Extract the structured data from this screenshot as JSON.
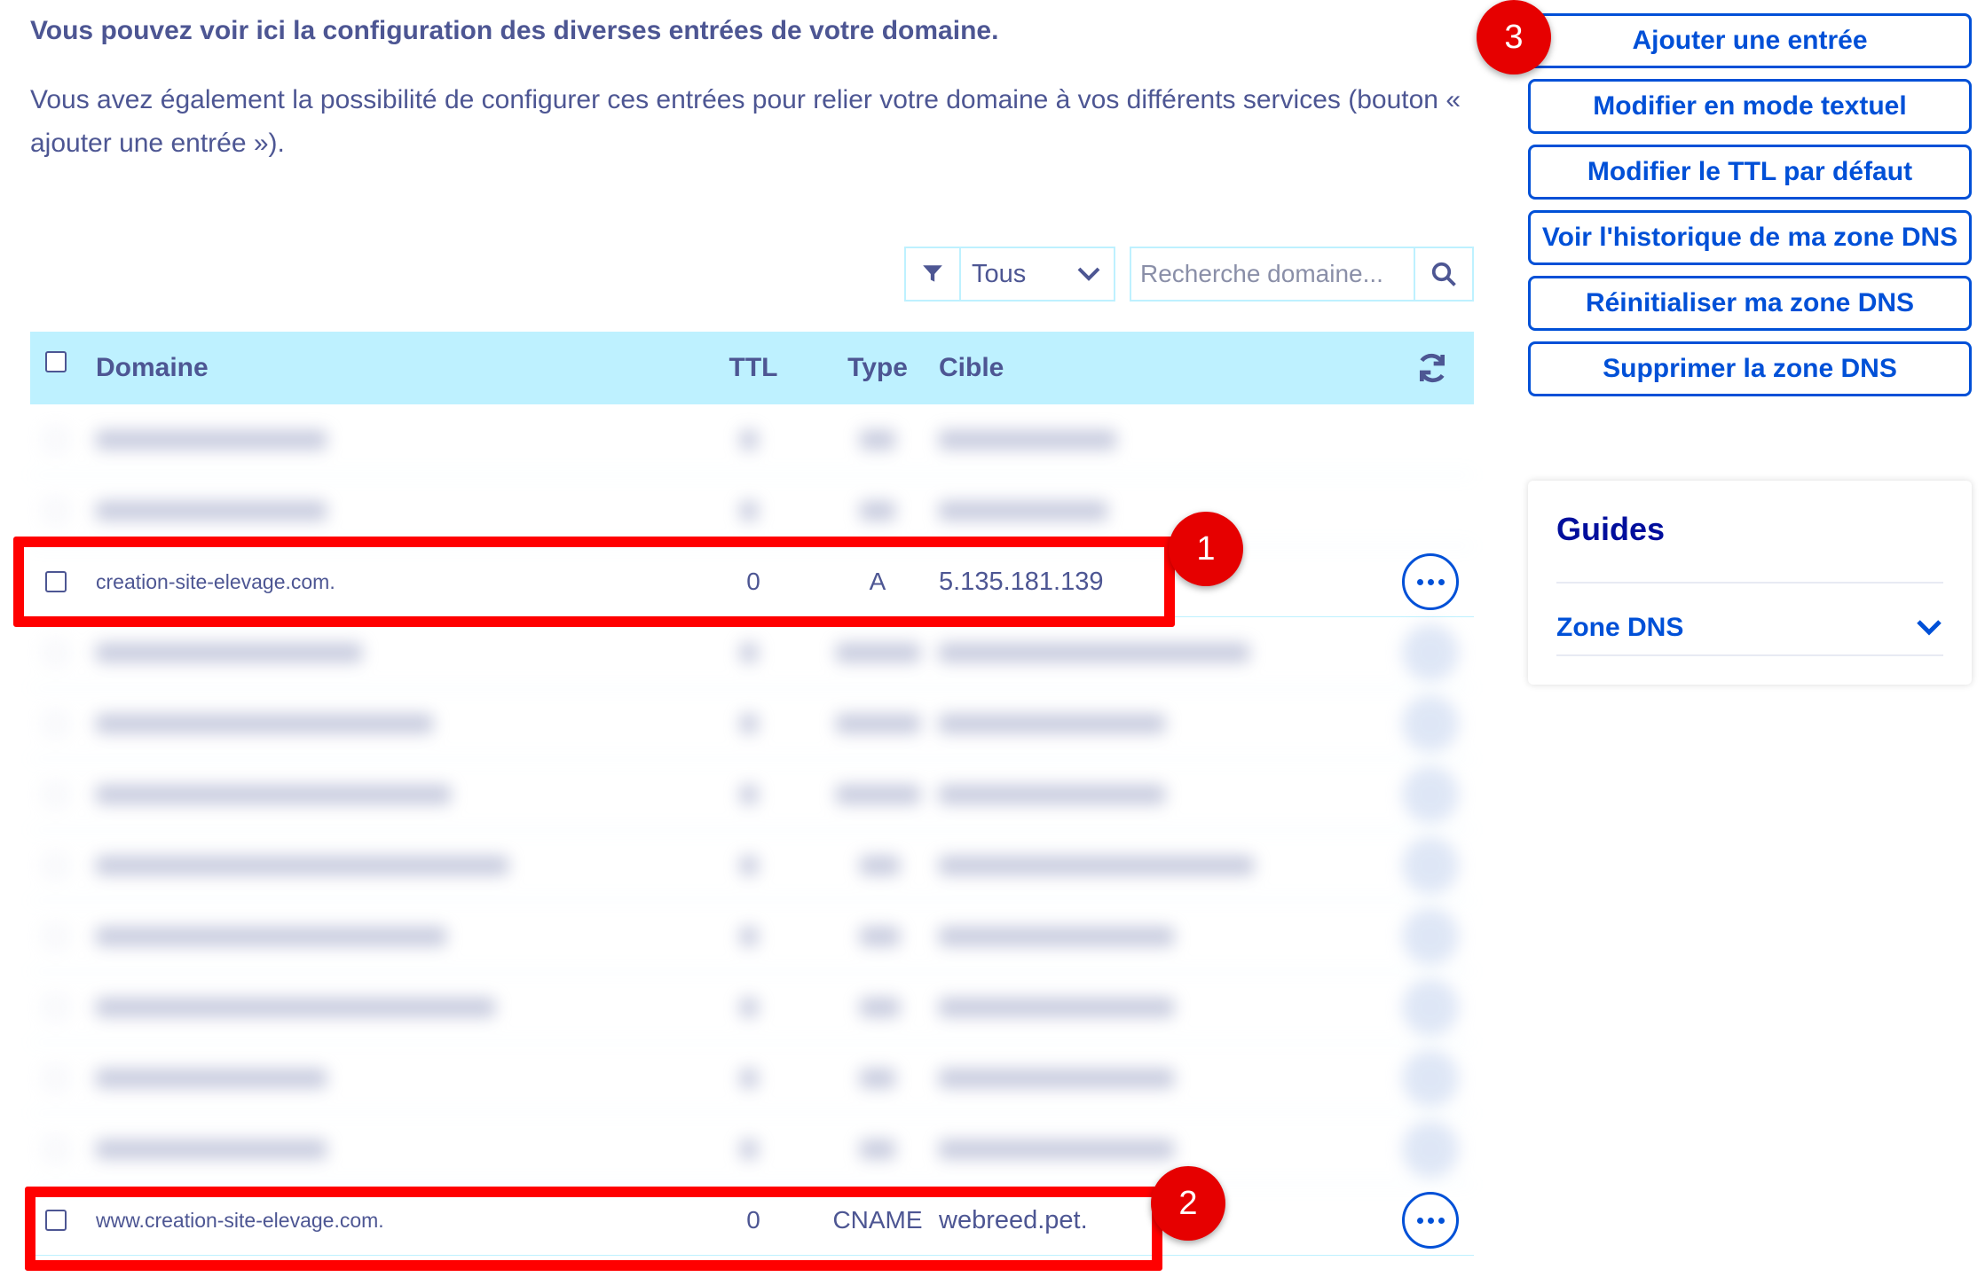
{
  "intro": {
    "bold": "Vous pouvez voir ici la configuration des diverses entrées de votre domaine.",
    "line1": "Vous avez également la possibilité de configurer ces entrées pour relier votre domaine à vos différents services (bouton «",
    "line2": "ajouter une entrée »)."
  },
  "filter": {
    "value": "Tous"
  },
  "search": {
    "placeholder": "Recherche domaine..."
  },
  "table": {
    "headers": {
      "domain": "Domaine",
      "ttl": "TTL",
      "type": "Type",
      "target": "Cible"
    },
    "highlighted_rows": [
      {
        "domain": "creation-site-elevage.com.",
        "ttl": "0",
        "type": "A",
        "target": "5.135.181.139"
      },
      {
        "domain": "www.creation-site-elevage.com.",
        "ttl": "0",
        "type": "CNAME",
        "target": "webreed.pet."
      }
    ]
  },
  "annotations": {
    "badge1": "1",
    "badge2": "2",
    "badge3": "3"
  },
  "actions": {
    "add_entry": "Ajouter une entrée",
    "edit_text_mode": "Modifier en mode textuel",
    "edit_default_ttl": "Modifier le TTL par défaut",
    "view_history": "Voir l'historique de ma zone DNS",
    "reset_zone": "Réinitialiser ma zone DNS",
    "delete_zone": "Supprimer la zone DNS"
  },
  "guides": {
    "title": "Guides",
    "item": "Zone DNS"
  },
  "colors": {
    "accent": "#0050d7",
    "text": "#4d5693",
    "header_bg": "#bef1ff",
    "highlight": "#ff0000"
  }
}
